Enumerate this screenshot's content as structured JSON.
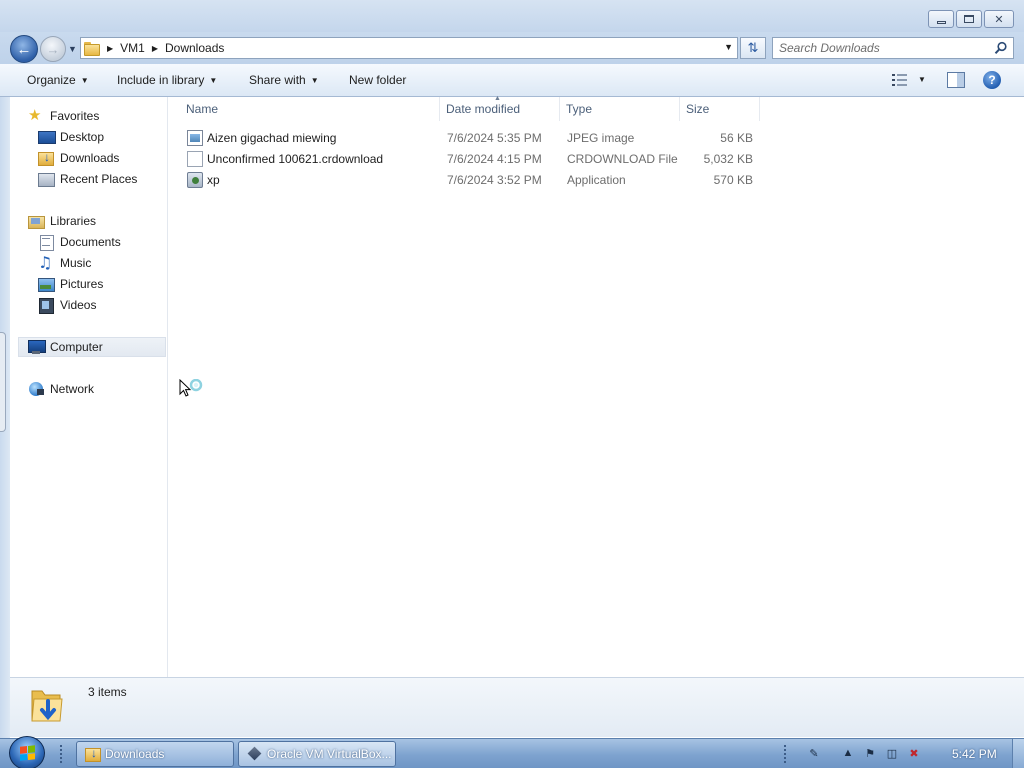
{
  "window": {
    "minimize_glyph": "",
    "maximize_glyph": "",
    "close_glyph": "✕"
  },
  "address": {
    "crumbs": [
      "VM1",
      "Downloads"
    ],
    "search_placeholder": "Search Downloads"
  },
  "toolbar": {
    "organize": "Organize",
    "include_in_library": "Include in library",
    "share_with": "Share with",
    "new_folder": "New folder"
  },
  "sidebar": {
    "favorites": {
      "label": "Favorites",
      "items": [
        {
          "label": "Desktop",
          "icon": "desktop-icon"
        },
        {
          "label": "Downloads",
          "icon": "downloads-folder-icon"
        },
        {
          "label": "Recent Places",
          "icon": "recent-places-icon"
        }
      ]
    },
    "libraries": {
      "label": "Libraries",
      "items": [
        {
          "label": "Documents",
          "icon": "documents-icon"
        },
        {
          "label": "Music",
          "icon": "music-icon"
        },
        {
          "label": "Pictures",
          "icon": "pictures-icon"
        },
        {
          "label": "Videos",
          "icon": "videos-icon"
        }
      ]
    },
    "computer": {
      "label": "Computer",
      "icon": "computer-icon"
    },
    "network": {
      "label": "Network",
      "icon": "network-icon"
    }
  },
  "file_list": {
    "columns": [
      "Name",
      "Date modified",
      "Type",
      "Size"
    ],
    "rows": [
      {
        "name": "Aizen gigachad miewing",
        "date": "7/6/2024 5:35 PM",
        "type": "JPEG image",
        "size": "56 KB",
        "icon": "jpeg-file-icon"
      },
      {
        "name": "Unconfirmed 100621.crdownload",
        "date": "7/6/2024 4:15 PM",
        "type": "CRDOWNLOAD File",
        "size": "5,032 KB",
        "icon": "blank-file-icon"
      },
      {
        "name": "xp",
        "date": "7/6/2024 3:52 PM",
        "type": "Application",
        "size": "570 KB",
        "icon": "application-icon"
      }
    ]
  },
  "details": {
    "item_count": "3 items"
  },
  "taskbar": {
    "buttons": [
      {
        "label": "Downloads",
        "icon": "explorer-folder-icon"
      },
      {
        "label": "Oracle VM VirtualBox...",
        "icon": "virtualbox-icon"
      }
    ],
    "clock": "5:42 PM"
  },
  "colors": {
    "accent": "#2e5fa8",
    "titlebar": "#c4d6ec",
    "secondary_text": "#6d6d6d"
  }
}
